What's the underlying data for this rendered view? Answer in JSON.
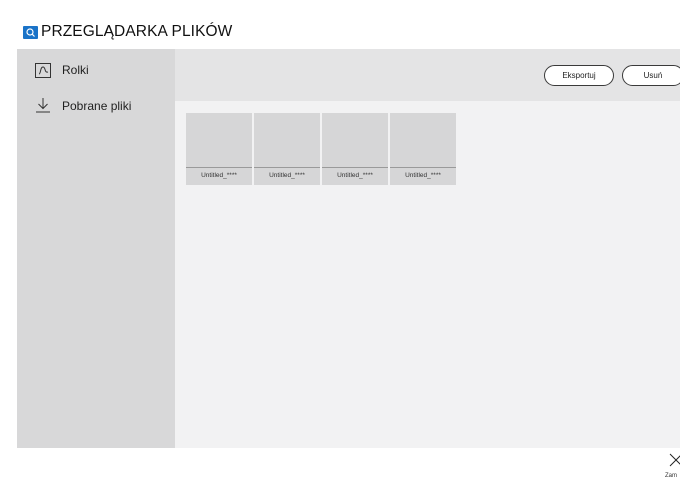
{
  "app": {
    "title": "PRZEGLĄDARKA PLIKÓW",
    "accent_color": "#1a73c8"
  },
  "sidebar": {
    "items": [
      {
        "label": "Rolki",
        "icon": "reels-icon"
      },
      {
        "label": "Pobrane pliki",
        "icon": "download-icon"
      }
    ]
  },
  "toolbar": {
    "export_label": "Eksportuj",
    "delete_label": "Usuń"
  },
  "files": [
    {
      "name": "Untitled_****"
    },
    {
      "name": "Untitled_****"
    },
    {
      "name": "Untitled_****"
    },
    {
      "name": "Untitled_****"
    }
  ],
  "footer": {
    "close_label": "Zam",
    "close_icon": "close-icon"
  }
}
